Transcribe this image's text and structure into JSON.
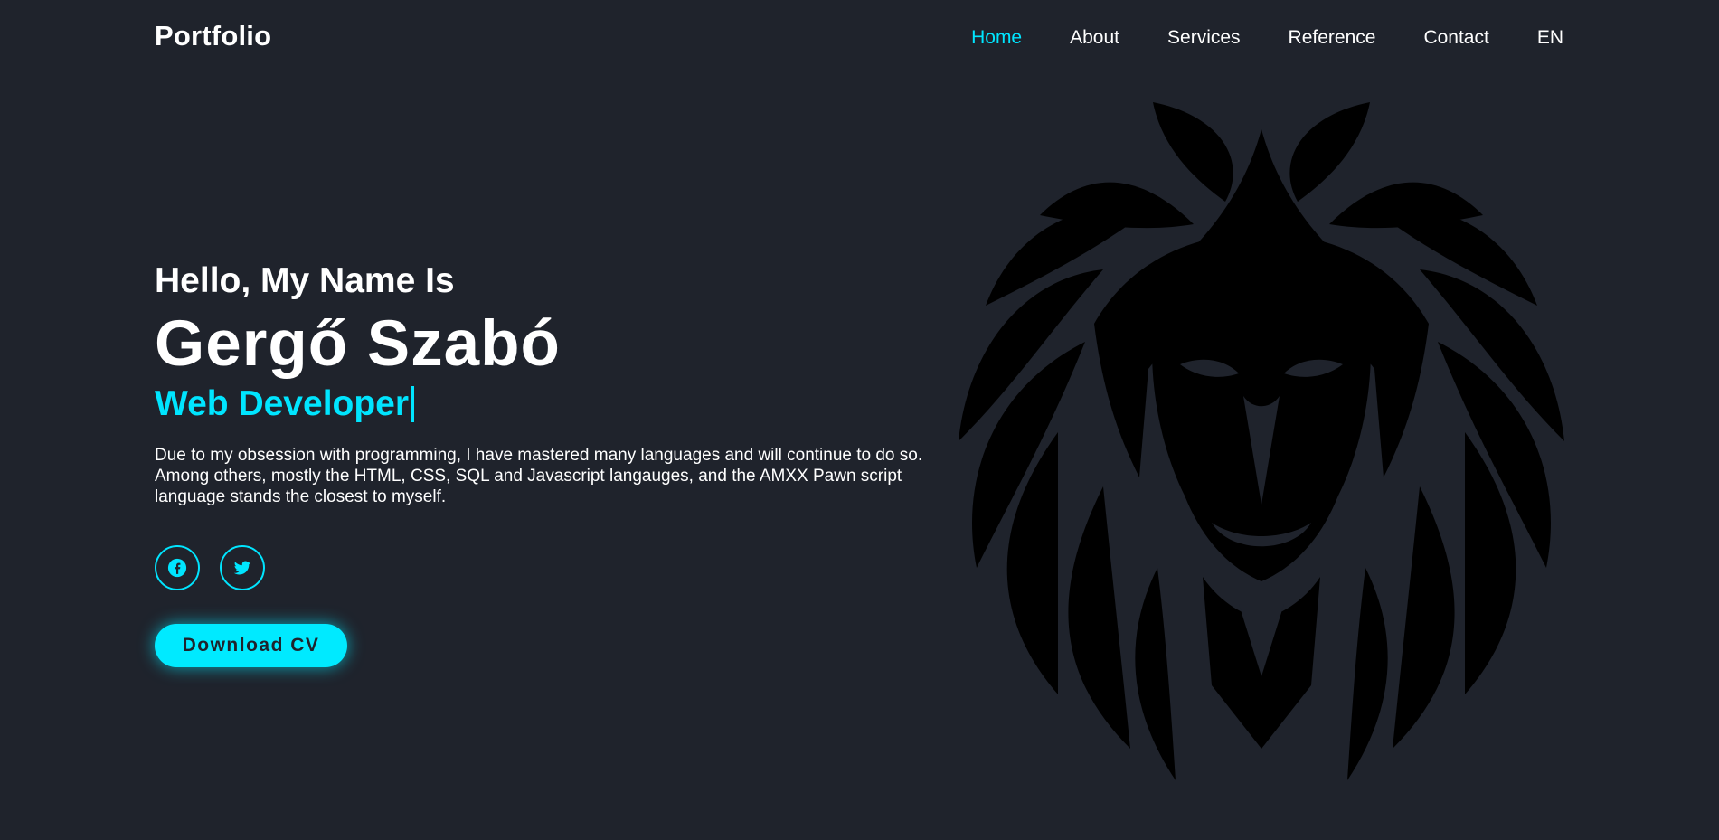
{
  "header": {
    "logo": "Portfolio",
    "nav": [
      {
        "label": "Home",
        "active": true
      },
      {
        "label": "About",
        "active": false
      },
      {
        "label": "Services",
        "active": false
      },
      {
        "label": "Reference",
        "active": false
      },
      {
        "label": "Contact",
        "active": false
      },
      {
        "label": "EN",
        "active": false
      }
    ]
  },
  "hero": {
    "greeting": "Hello, My Name Is",
    "name": "Gergő Szabó",
    "role": "Web Developer",
    "bio": "Due to my obsession with programming, I have mastered many languages and will continue to do so. Among others, mostly the HTML, CSS, SQL and Javascript langauges, and the AMXX Pawn script language stands the closest to myself."
  },
  "social": [
    {
      "icon": "facebook-icon"
    },
    {
      "icon": "twitter-icon"
    }
  ],
  "cta": {
    "download_label": "Download CV"
  },
  "colors": {
    "background": "#1f232c",
    "accent": "#00e5ff",
    "text": "#ffffff",
    "lion": "#000000"
  }
}
